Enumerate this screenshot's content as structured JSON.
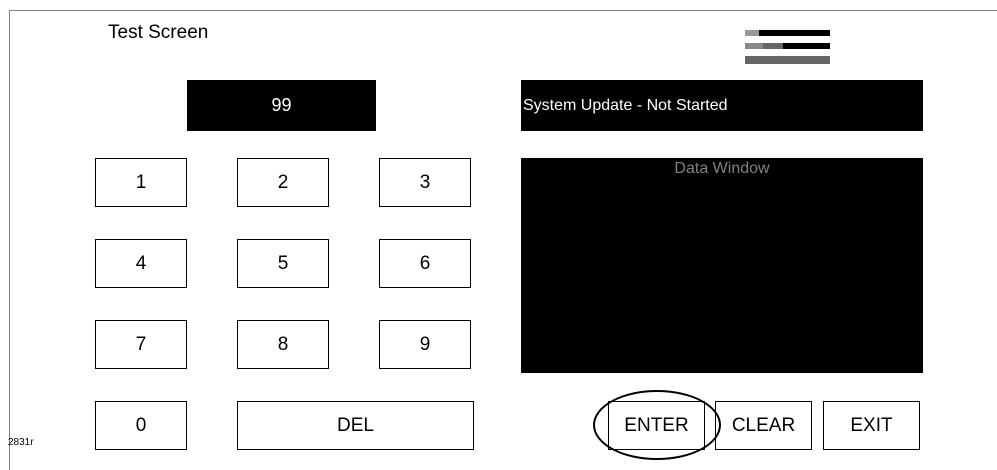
{
  "screen": {
    "title": "Test Screen",
    "figure_id": "2831r"
  },
  "keypad": {
    "display_value": "99",
    "keys": [
      "1",
      "2",
      "3",
      "4",
      "5",
      "6",
      "7",
      "8",
      "9",
      "0"
    ],
    "del_label": "DEL"
  },
  "status": {
    "text": "System Update - Not Started"
  },
  "data_window": {
    "label": "Data Window"
  },
  "actions": {
    "enter_label": "ENTER",
    "clear_label": "CLEAR",
    "exit_label": "EXIT"
  },
  "colors": {
    "panel": "#000000",
    "panel_text": "#ffffff",
    "data_window_label": "#808080"
  }
}
